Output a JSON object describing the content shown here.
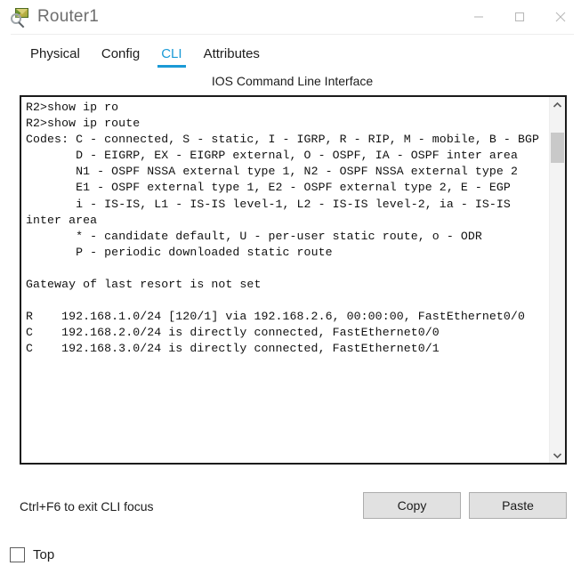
{
  "window": {
    "title": "Router1",
    "icon": "router-magnifier-icon",
    "controls": [
      {
        "name": "minimize",
        "glyph": "minimize-icon"
      },
      {
        "name": "maximize",
        "glyph": "maximize-icon"
      },
      {
        "name": "close",
        "glyph": "close-icon"
      }
    ]
  },
  "tabs": [
    {
      "label": "Physical",
      "active": false
    },
    {
      "label": "Config",
      "active": false
    },
    {
      "label": "CLI",
      "active": true
    },
    {
      "label": "Attributes",
      "active": false
    }
  ],
  "cli": {
    "header": "IOS Command Line Interface",
    "accent_color": "#1a9ad6",
    "text": "R2>show ip ro\nR2>show ip route\nCodes: C - connected, S - static, I - IGRP, R - RIP, M - mobile, B - BGP\n       D - EIGRP, EX - EIGRP external, O - OSPF, IA - OSPF inter area\n       N1 - OSPF NSSA external type 1, N2 - OSPF NSSA external type 2\n       E1 - OSPF external type 1, E2 - OSPF external type 2, E - EGP\n       i - IS-IS, L1 - IS-IS level-1, L2 - IS-IS level-2, ia - IS-IS inter area\n       * - candidate default, U - per-user static route, o - ODR\n       P - periodic downloaded static route\n\nGateway of last resort is not set\n\nR    192.168.1.0/24 [120/1] via 192.168.2.6, 00:00:00, FastEthernet0/0\nC    192.168.2.0/24 is directly connected, FastEthernet0/0\nC    192.168.3.0/24 is directly connected, FastEthernet0/1"
  },
  "footer": {
    "hint": "Ctrl+F6 to exit CLI focus",
    "copy_label": "Copy",
    "paste_label": "Paste"
  },
  "bottom": {
    "top_checkbox_label": "Top",
    "top_checked": false
  }
}
